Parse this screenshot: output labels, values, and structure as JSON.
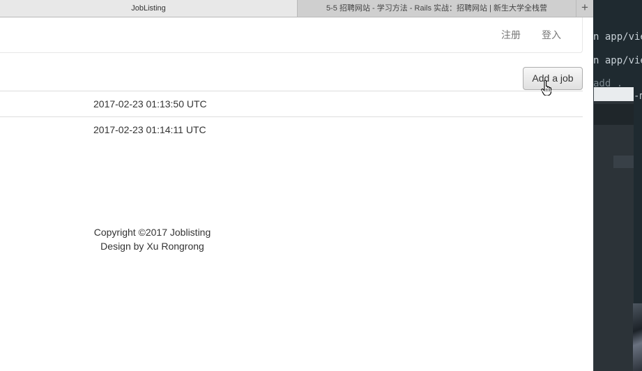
{
  "browser": {
    "tabs": [
      {
        "label": "JobListing",
        "active": true
      },
      {
        "label": "5-5 招聘网站 - 学习方法 - Rails 实战：招聘网站 | 新生大学全栈营",
        "active": false
      }
    ],
    "new_tab_symbol": "+"
  },
  "navbar": {
    "register_label": "注册",
    "login_label": "登入"
  },
  "add_job_label": "Add a job",
  "jobs": {
    "rows": [
      {
        "created_at": "2017-02-23 01:13:50 UTC"
      },
      {
        "created_at": "2017-02-23 01:14:11 UTC"
      }
    ]
  },
  "footer": {
    "copyright": "Copyright ©2017 Joblisting",
    "designer": "Design by Xu Rongrong"
  },
  "terminal": {
    "lines": [
      "n app/vie",
      "n app/vie",
      "add .",
      "-m"
    ]
  },
  "colors": {
    "link": "#777777",
    "terminal_bg": "#1f2a30"
  }
}
